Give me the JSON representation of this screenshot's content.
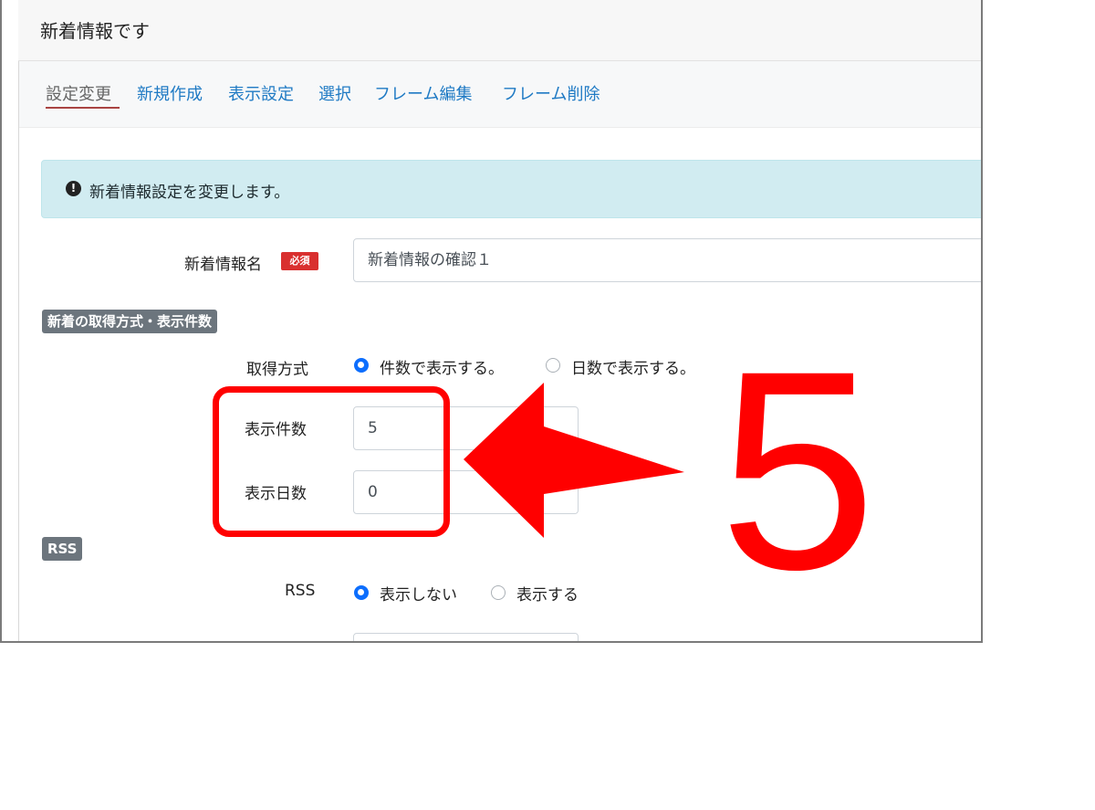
{
  "frame": {
    "title": "新着情報です"
  },
  "tabs": [
    {
      "label": "設定変更",
      "active": true
    },
    {
      "label": "新規作成"
    },
    {
      "label": "表示設定"
    },
    {
      "label": "選択"
    },
    {
      "label": "フレーム編集"
    },
    {
      "label": "フレーム削除"
    }
  ],
  "alert": {
    "icon": "exclamation-circle-icon",
    "text": "新着情報設定を変更します。"
  },
  "form": {
    "name_label": "新着情報名",
    "required_badge": "必須",
    "name_value": "新着情報の確認１",
    "section_fetch": "新着の取得方式・表示件数",
    "fetch_method_label": "取得方式",
    "fetch_option_count": "件数で表示する。",
    "fetch_option_days": "日数で表示する。",
    "display_count_label": "表示件数",
    "display_count_value": "5",
    "display_days_label": "表示日数",
    "display_days_value": "0",
    "section_rss": "RSS",
    "rss_label": "RSS",
    "rss_option_hide": "表示しない",
    "rss_option_show": "表示する"
  },
  "annotation": {
    "step_number": "5",
    "color": "#ff0000"
  }
}
